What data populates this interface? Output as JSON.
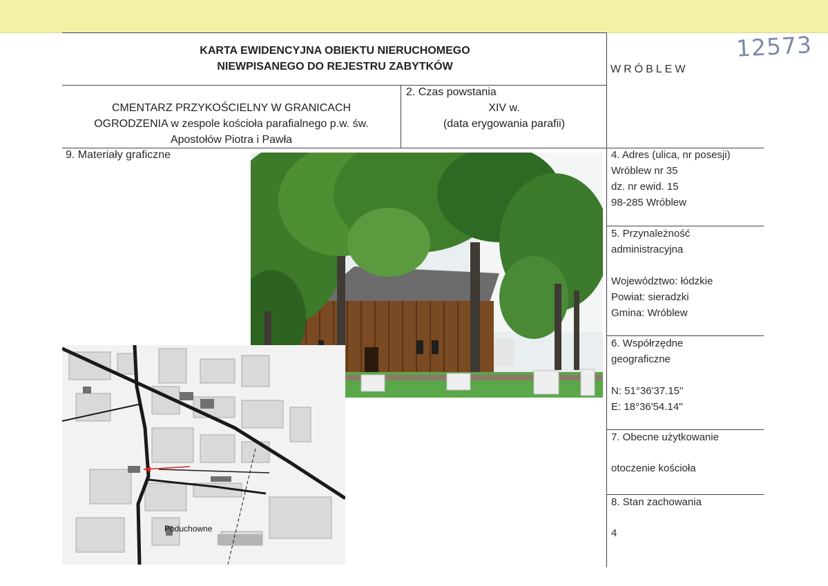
{
  "header": {
    "title_line1": "KARTA EWIDENCYJNA OBIEKTU NIERUCHOMEGO",
    "title_line2": "NIEWPISANEGO DO REJESTRU ZABYTKÓW",
    "locality": "WRÓBLEW",
    "register_number": "12573"
  },
  "object": {
    "name_line1": "CMENTARZ PRZYKOŚCIELNY W GRANICACH",
    "name_line2": "OGRODZENIA w zespole kościoła parafialnego p.w. św.",
    "name_line3": "Apostołów Piotra i Pawła"
  },
  "czas": {
    "label": "2. Czas powstania",
    "value": "XIV w.",
    "note": "(data erygowania parafii)"
  },
  "materialy": {
    "label": "9. Materiały graficzne",
    "map_label": "Poduchowne"
  },
  "adres": {
    "label": "4. Adres (ulica, nr posesji)",
    "line1": "Wróblew nr 35",
    "line2": "dz. nr ewid. 15",
    "line3": "98-285 Wróblew"
  },
  "przynaleznosc": {
    "label1": "5. Przynależność",
    "label2": "administracyjna",
    "wojewodztwo": "Województwo: łódzkie",
    "powiat": "Powiat: sieradzki",
    "gmina": "Gmina: Wróblew"
  },
  "wspolrzedne": {
    "label1": "6. Współrzędne",
    "label2": "geograficzne",
    "n": "N: 51°36'37.15''",
    "e": "E: 18°36'54.14''"
  },
  "uzytkowanie": {
    "label": "7. Obecne użytkowanie",
    "value": "otoczenie kościoła"
  },
  "stan": {
    "label": "8. Stan zachowania",
    "value": "4"
  }
}
